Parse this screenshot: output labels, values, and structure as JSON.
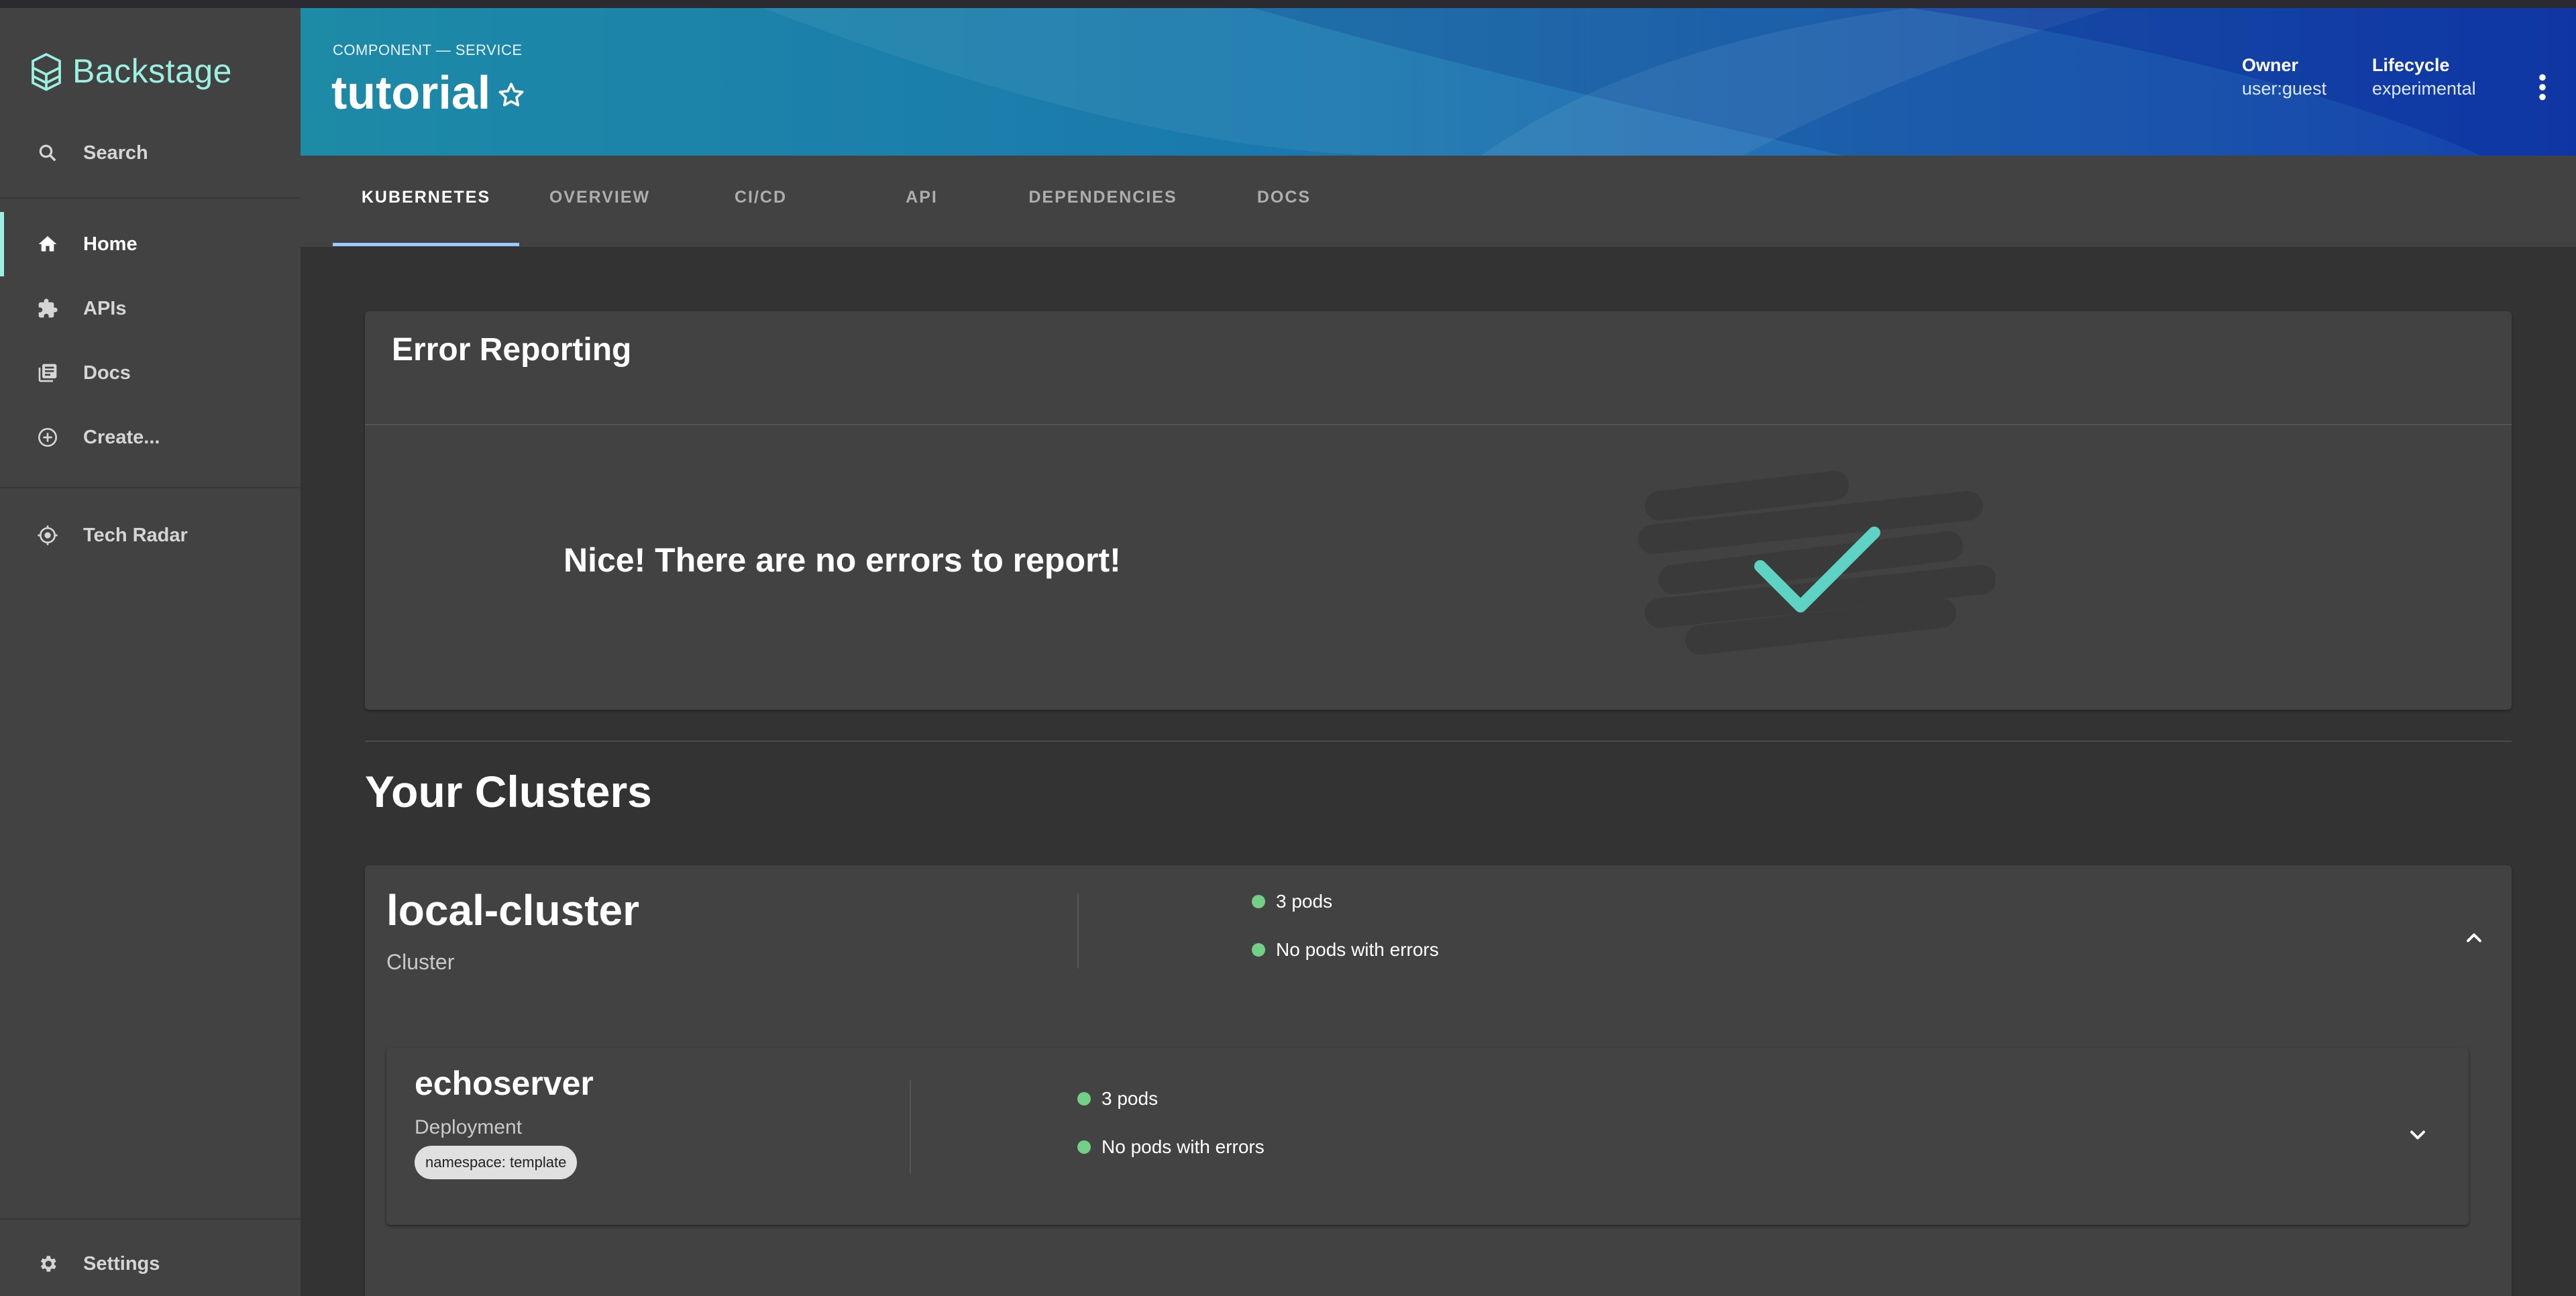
{
  "app": {
    "name": "Backstage"
  },
  "sidebar": {
    "search_label": "Search",
    "items": [
      {
        "label": "Home",
        "icon": "home-icon",
        "active": true
      },
      {
        "label": "APIs",
        "icon": "puzzle-icon",
        "active": false
      },
      {
        "label": "Docs",
        "icon": "library-icon",
        "active": false
      },
      {
        "label": "Create...",
        "icon": "add-circle-icon",
        "active": false
      },
      {
        "label": "Tech Radar",
        "icon": "radar-icon",
        "active": false
      }
    ],
    "settings_label": "Settings"
  },
  "header": {
    "subtitle": "COMPONENT — SERVICE",
    "title": "tutorial",
    "owner_label": "Owner",
    "owner_value": "user:guest",
    "lifecycle_label": "Lifecycle",
    "lifecycle_value": "experimental"
  },
  "tabs": [
    {
      "label": "KUBERNETES",
      "active": true
    },
    {
      "label": "OVERVIEW",
      "active": false
    },
    {
      "label": "CI/CD",
      "active": false
    },
    {
      "label": "API",
      "active": false
    },
    {
      "label": "DEPENDENCIES",
      "active": false
    },
    {
      "label": "DOCS",
      "active": false
    }
  ],
  "error_reporting": {
    "title": "Error Reporting",
    "message": "Nice! There are no errors to report!"
  },
  "clusters": {
    "section_title": "Your Clusters",
    "cluster": {
      "name": "local-cluster",
      "type": "Cluster",
      "pods": "3 pods",
      "errors": "No pods with errors"
    },
    "deployment": {
      "name": "echoserver",
      "type": "Deployment",
      "namespace_chip": "namespace: template",
      "pods": "3 pods",
      "errors": "No pods with errors"
    }
  },
  "colors": {
    "accent": "#9bf0e1",
    "status_ok": "#71cf87",
    "sidebar_bg": "#424242",
    "page_bg": "#333333"
  }
}
